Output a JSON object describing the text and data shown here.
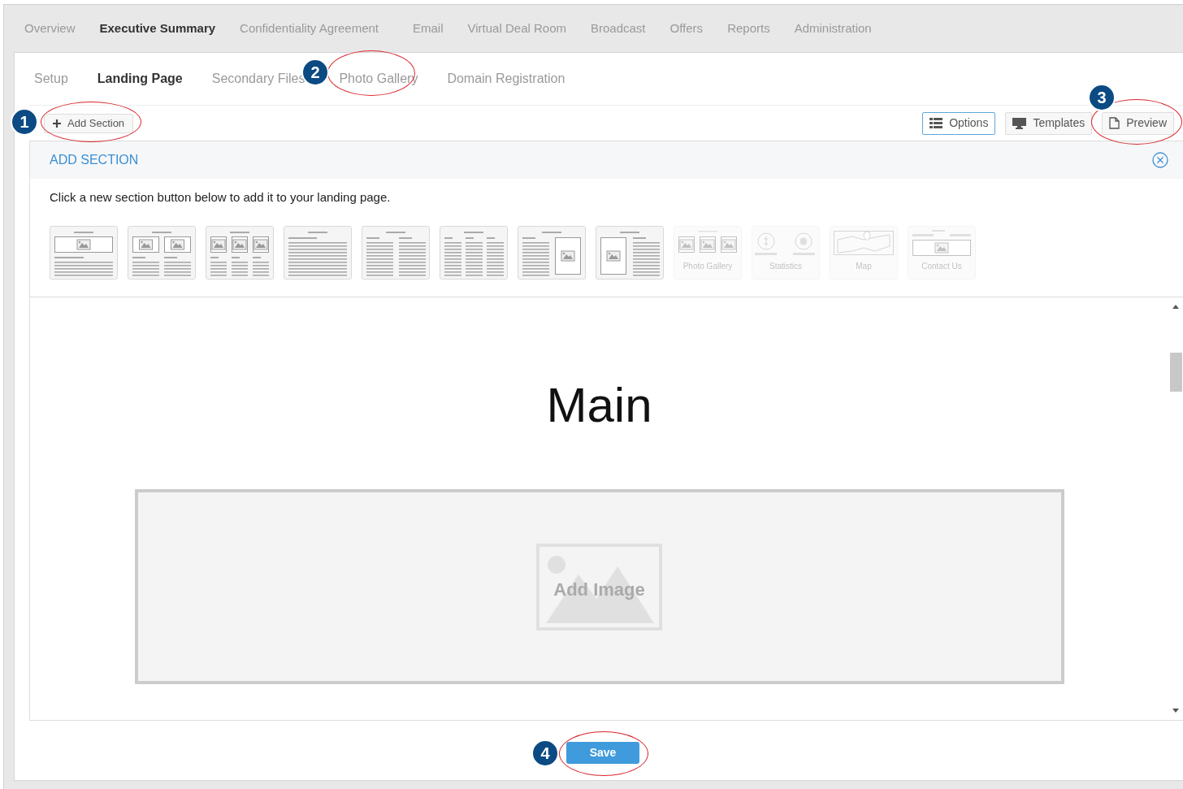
{
  "top_tabs": [
    {
      "label": "Overview",
      "selected": false
    },
    {
      "label": "Executive Summary",
      "selected": true
    },
    {
      "label": "Confidentiality Agreement",
      "selected": false
    },
    {
      "label": "Email",
      "selected": false
    },
    {
      "label": "Virtual Deal Room",
      "selected": false
    },
    {
      "label": "Broadcast",
      "selected": false
    },
    {
      "label": "Offers",
      "selected": false
    },
    {
      "label": "Reports",
      "selected": false
    },
    {
      "label": "Administration",
      "selected": false
    }
  ],
  "sub_tabs": [
    {
      "label": "Setup",
      "selected": false
    },
    {
      "label": "Landing Page",
      "selected": true
    },
    {
      "label": "Secondary Files",
      "selected": false
    },
    {
      "label": "Photo Gallery",
      "selected": false
    },
    {
      "label": "Domain Registration",
      "selected": false
    }
  ],
  "toolbar": {
    "add_section": "Add Section",
    "view_buttons": [
      {
        "label": "Options",
        "selected": true,
        "kind": "options"
      },
      {
        "label": "Templates",
        "selected": false,
        "kind": "templates"
      },
      {
        "label": "Preview",
        "selected": false,
        "kind": "preview"
      }
    ]
  },
  "add_section_panel": {
    "title": "ADD SECTION",
    "instruction": "Click a new section button below to add it to your landing page.",
    "tiles": [
      {
        "kind": "banner",
        "disabled": false
      },
      {
        "kind": "two-images",
        "disabled": false
      },
      {
        "kind": "three-images",
        "disabled": false
      },
      {
        "kind": "text",
        "disabled": false
      },
      {
        "kind": "two-columns",
        "disabled": false
      },
      {
        "kind": "three-columns",
        "disabled": false
      },
      {
        "kind": "text-image",
        "disabled": false
      },
      {
        "kind": "image-text",
        "disabled": false
      },
      {
        "kind": "gallery",
        "label": "Photo Gallery",
        "disabled": true
      },
      {
        "kind": "statistics",
        "label": "Statistics",
        "disabled": true
      },
      {
        "kind": "map",
        "label": "Map",
        "disabled": true
      },
      {
        "kind": "contact",
        "label": "Contact Us",
        "disabled": true
      }
    ]
  },
  "canvas": {
    "heading": "Main",
    "image_placeholder": "Add Image"
  },
  "save_button": "Save",
  "callouts": [
    {
      "number": "1"
    },
    {
      "number": "2"
    },
    {
      "number": "3"
    },
    {
      "number": "4"
    }
  ]
}
